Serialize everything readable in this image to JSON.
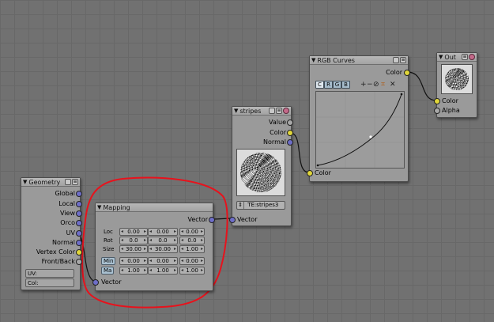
{
  "nodes": {
    "geometry": {
      "title": "Geometry",
      "outputs": [
        "Global",
        "Local",
        "View",
        "Orco",
        "UV",
        "Normal",
        "Vertex Color",
        "Front/Back"
      ],
      "uv_label": "UV:",
      "col_label": "Col:"
    },
    "mapping": {
      "title": "Mapping",
      "output": "Vector",
      "input": "Vector",
      "rows": [
        {
          "label": "Loc",
          "values": [
            "0.00",
            "0.00",
            "0.00"
          ]
        },
        {
          "label": "Rot",
          "values": [
            "0.0",
            "0.0",
            "0.0"
          ]
        },
        {
          "label": "Size",
          "values": [
            "30.00",
            "30.00",
            "1.00"
          ]
        },
        {
          "label": "Min",
          "values": [
            "0.00",
            "0.00",
            "0.00"
          ]
        },
        {
          "label": "Ma",
          "values": [
            "1.00",
            "1.00",
            "1.00"
          ]
        }
      ]
    },
    "stripes": {
      "title": "stripes",
      "outputs": [
        "Value",
        "Color",
        "Normal"
      ],
      "input": "Vector",
      "texture_name": "TE:stripes3"
    },
    "rgb_curves": {
      "title": "RGB Curves",
      "output": "Color",
      "input": "Color",
      "channels": [
        "C",
        "R",
        "G",
        "B"
      ],
      "active_channel": "C",
      "tools": [
        "+",
        "−",
        "zoom-icon",
        "clip-icon",
        "delete-icon"
      ]
    },
    "output": {
      "title": "Out",
      "inputs": [
        "Color",
        "Alpha"
      ]
    }
  },
  "colors": {
    "vector_socket": "#6e6ec8",
    "color_socket": "#e0d63a",
    "value_socket": "#a8a8a8",
    "annotation": "#e8121c",
    "background": "#717171"
  }
}
